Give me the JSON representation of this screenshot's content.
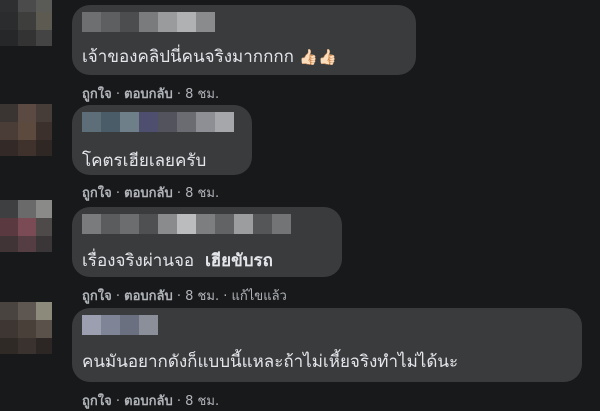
{
  "comments": [
    {
      "text": "เจ้าของคลิปนี่คนจริงมากกกก",
      "reactions": "👍🏻👍🏻",
      "like": "ถูกใจ",
      "reply": "ตอบกลับ",
      "time": "8 ชม."
    },
    {
      "text": "โคตรเฮียเลยครับ",
      "like": "ถูกใจ",
      "reply": "ตอบกลับ",
      "time": "8 ชม."
    },
    {
      "text": "เรื่องจริงผ่านจอ",
      "mention": "เฮียขับรถ",
      "like": "ถูกใจ",
      "reply": "ตอบกลับ",
      "time": "8 ชม.",
      "edited": "แก้ไขแล้ว"
    },
    {
      "text": "คนมันอยากดังก็แบบนี้แหละถ้าไม่เหี้ยจริงทำไม่ได้นะ",
      "like": "ถูกใจ",
      "reply": "ตอบกลับ",
      "time": "8 ชม."
    }
  ],
  "separator": "·",
  "colors": {
    "background": "#18191a",
    "bubble": "#3a3b3c",
    "text": "#e4e6eb",
    "meta": "#b0b3b8"
  }
}
